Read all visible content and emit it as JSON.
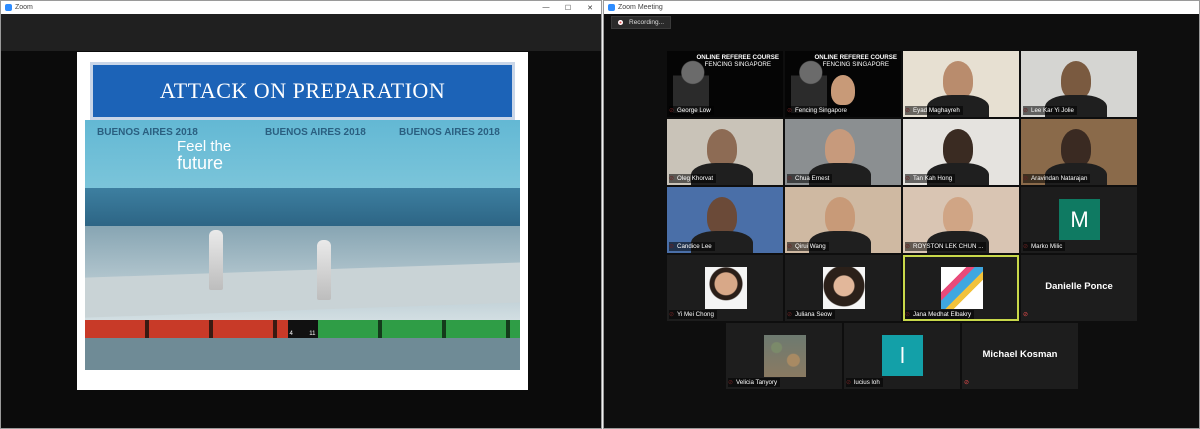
{
  "share_window": {
    "title": "Zoom",
    "controls": {
      "minimize": "—",
      "maximize": "☐",
      "close": "✕"
    },
    "slide": {
      "title": "ATTACK ON PREPARATION",
      "photo": {
        "brand_left": "BUENOS AIRES 2018",
        "brand_mid": "BUENOS AIRES 2018",
        "brand_right": "BUENOS AIRES 2018",
        "slogan_line1": "Feel the",
        "slogan_line2": "future",
        "score_left": "4",
        "score_right": "11"
      }
    }
  },
  "meeting_window": {
    "title": "Zoom Meeting",
    "recording_label": "Recording...",
    "participants": [
      {
        "name": "George Low",
        "type": "course",
        "line1": "ONLINE REFEREE COURSE",
        "line2": "FENCING SINGAPORE"
      },
      {
        "name": "Fencing Singapore",
        "type": "course",
        "line1": "ONLINE REFEREE COURSE",
        "line2": "FENCING SINGAPORE"
      },
      {
        "name": "Eyad Maghayreh",
        "type": "video"
      },
      {
        "name": "Lee Kar Yi Jolie",
        "type": "video"
      },
      {
        "name": "Oleg Khorvat",
        "type": "video"
      },
      {
        "name": "Chua Ernest",
        "type": "video"
      },
      {
        "name": "Tan Kah Hong",
        "type": "video"
      },
      {
        "name": "Aravindan Natarajan",
        "type": "video"
      },
      {
        "name": "Candice Lee",
        "type": "video"
      },
      {
        "name": "Qirui Wang",
        "type": "video"
      },
      {
        "name": "ROYSTON LEK CHUN ...",
        "type": "video"
      },
      {
        "name": "Marko Milic",
        "type": "avatar",
        "initial": "M",
        "color": "#0f7a62"
      },
      {
        "name": "Yi Mei Chong",
        "type": "picture"
      },
      {
        "name": "Juliana Seow",
        "type": "picture"
      },
      {
        "name": "Jana Medhat Elbakry",
        "type": "picture",
        "selected": true
      },
      {
        "name": "Danielle Ponce",
        "type": "name"
      },
      {
        "name": "Velicia Tanyory",
        "type": "picture"
      },
      {
        "name": "lucius loh",
        "type": "avatar",
        "initial": "l",
        "color": "#13a0a8"
      },
      {
        "name": "Michael Kosman",
        "type": "name"
      }
    ]
  }
}
